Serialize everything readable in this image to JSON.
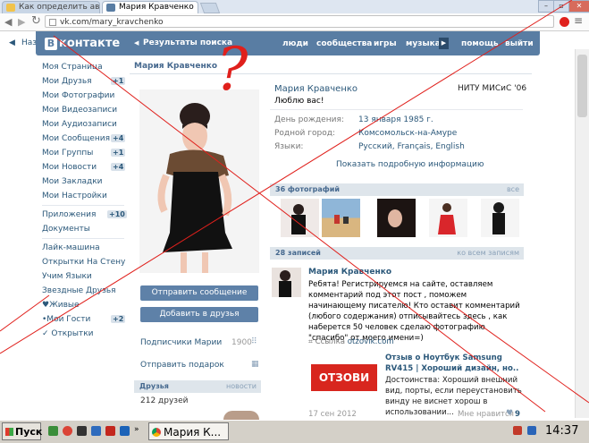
{
  "browser": {
    "tabs": [
      {
        "label": "Как определить ав"
      },
      {
        "label": "Мария Кравченко"
      }
    ],
    "url": "vk.com/mary_kravchenko",
    "back_label": "Наз"
  },
  "header": {
    "logo_letter": "В",
    "logo_text": "контакте",
    "search_back": "Результаты поиска",
    "nav": [
      "люди",
      "сообщества",
      "игры",
      "музыка",
      "помощь",
      "выйти"
    ]
  },
  "sidebar": {
    "items": [
      {
        "label": "Моя Страница",
        "badge": ""
      },
      {
        "label": "Мои Друзья",
        "badge": "+1"
      },
      {
        "label": "Мои Фотографии",
        "badge": ""
      },
      {
        "label": "Мои Видеозаписи",
        "badge": ""
      },
      {
        "label": "Мои Аудиозаписи",
        "badge": ""
      },
      {
        "label": "Мои Сообщения",
        "badge": "+4"
      },
      {
        "label": "Мои Группы",
        "badge": "+1"
      },
      {
        "label": "Мои Новости",
        "badge": "+4"
      },
      {
        "label": "Мои Закладки",
        "badge": ""
      },
      {
        "label": "Мои Настройки",
        "badge": ""
      }
    ],
    "apps": [
      {
        "label": "Приложения",
        "badge": "+10"
      },
      {
        "label": "Документы",
        "badge": ""
      }
    ],
    "extra": [
      {
        "label": "Лайк-машина",
        "badge": ""
      },
      {
        "label": "Открытки На Стену",
        "badge": ""
      },
      {
        "label": "Учим Языки",
        "badge": ""
      },
      {
        "label": "Звездные Друзья",
        "badge": ""
      },
      {
        "label": "♥Живые",
        "badge": ""
      },
      {
        "label": "•Мои Гости",
        "badge": "+2"
      },
      {
        "label": "✓ Открытки",
        "badge": ""
      }
    ]
  },
  "profile": {
    "page_title": "Мария Кравченко",
    "name": "Мария Кравченко",
    "university": "НИТУ МИСиС '06",
    "status": "Люблю вас!",
    "info": [
      {
        "label": "День рождения:",
        "value": "13 января 1985 г."
      },
      {
        "label": "Родной город:",
        "value": "Комсомольск-на-Амуре"
      },
      {
        "label": "Языки:",
        "value": "Русский, Français, English"
      }
    ],
    "show_more": "Показать подробную информацию",
    "send_message": "Отправить сообщение",
    "add_friend": "Добавить в друзья",
    "subscribers_label": "Подписчики Марии",
    "subscribers_count": "1900",
    "send_gift": "Отправить подарок",
    "friends_title": "Друзья",
    "friends_link": "новости",
    "friends_count": "212 друзей"
  },
  "photos": {
    "title": "36 фотографий",
    "link": "все"
  },
  "wall": {
    "title": "28 записей",
    "link": "ко всем записям",
    "post": {
      "author": "Мария Кравченко",
      "text": "Ребята! Регистрируемся на сайте, оставляем комментарий под этот пост , поможем начинающему писателю! Кто оставит комментарий (любого содержания) отписывайтесь здесь , как наберется 50 человек сделаю фотографию \"спасибо\" от моего имени=)",
      "link_prefix": "Ссылка",
      "link_domain": "otzovik.com",
      "share_logo": "ОТЗОВИ",
      "share_title": "Отзыв о Ноутбук Samsung RV415 | Хороший дизайн, но..",
      "share_text": "Достоинства: Хороший внешний вид, порты, если переустановить винду не виснет хорош в использовании...",
      "date": "17 сен 2012",
      "like_label": "Мне нравится",
      "like_count": "9"
    }
  },
  "taskbar": {
    "start": "Пуск",
    "window": "Мария К...",
    "clock": "14:37"
  },
  "overlay": {
    "mark": "?"
  },
  "colors": {
    "vk_blue": "#597da3",
    "link": "#2b587a",
    "annotation_red": "#e0201c"
  }
}
